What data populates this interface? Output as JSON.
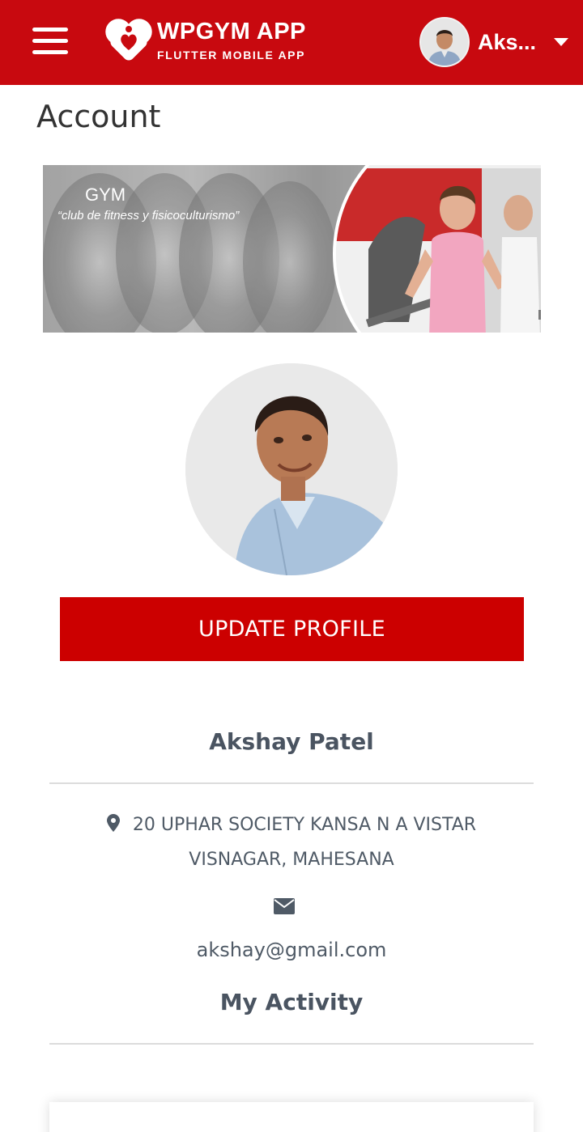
{
  "header": {
    "app_title": "WPGYM APP",
    "app_subtitle": "FLUTTER MOBILE APP",
    "user_name": "Aks...",
    "brand_color": "#c8090f"
  },
  "page": {
    "title": "Account"
  },
  "banner": {
    "title": "GYM",
    "tagline": "“club de fitness y fisicoculturismo”"
  },
  "profile": {
    "update_button_label": "UPDATE PROFILE",
    "name": "Akshay Patel",
    "address_line1": "20 UPHAR SOCIETY KANSA N A VISTAR",
    "address_line2": "VISNAGAR, MAHESANA",
    "email": "akshay@gmail.com",
    "button_color": "#cc0000"
  },
  "activity": {
    "heading": "My Activity"
  },
  "icons": {
    "menu": "hamburger-menu-icon",
    "logo": "heart-logo-icon",
    "dropdown": "caret-down-icon",
    "location": "map-pin-icon",
    "email": "envelope-icon"
  }
}
